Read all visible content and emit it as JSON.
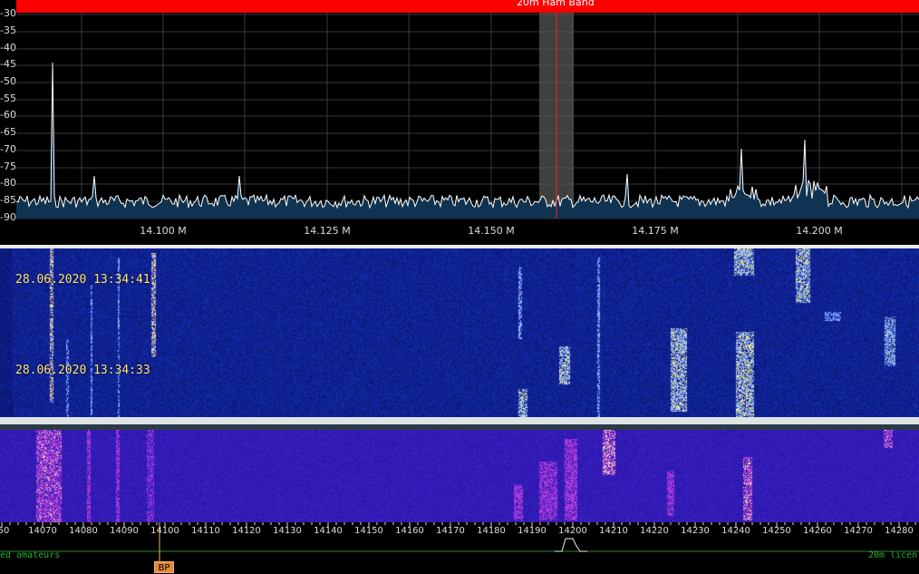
{
  "band_header": {
    "title": "20m Ham Band"
  },
  "spectrum": {
    "db_labels": [
      "-30",
      "-35",
      "-40",
      "-45",
      "-50",
      "-55",
      "-60",
      "-65",
      "-70",
      "-75",
      "-80",
      "-85",
      "-90"
    ],
    "freq_labels": [
      "14.100 M",
      "14.125 M",
      "14.150 M",
      "14.175 M",
      "14.200 M"
    ],
    "colors": {
      "fill": "#0f3350",
      "trace": "#ffffff",
      "grid": "#3a3a3a",
      "marker": "#ff2020",
      "passband": "#555555"
    }
  },
  "waterfall": {
    "timestamps": [
      "28.06.2020 13:34:41",
      "28.06.2020 13:34:33"
    ]
  },
  "scale": {
    "labels": [
      "50",
      "14070",
      "14080",
      "14090",
      "14100",
      "14110",
      "14120",
      "14130",
      "14140",
      "14150",
      "14160",
      "14170",
      "14180",
      "14190",
      "14200",
      "14210",
      "14220",
      "14230",
      "14240",
      "14250",
      "14260",
      "14270",
      "14280"
    ],
    "band_left": "ed amateurs",
    "band_right": "20m licen",
    "marker_label": "BP"
  }
}
